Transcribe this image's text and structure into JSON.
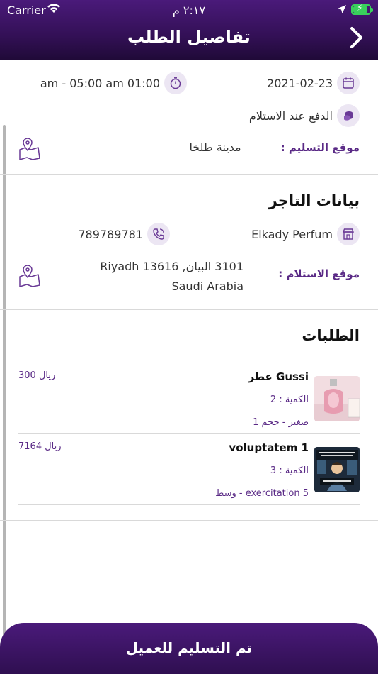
{
  "status_bar": {
    "carrier": "Carrier",
    "time": "٢:١٧ م"
  },
  "nav": {
    "title": "تفاصيل الطلب"
  },
  "delivery": {
    "date": "2021-02-23",
    "time_range": "01:00 am - 05:00 am",
    "payment_method": "الدفع عند الاستلام",
    "location_label": "موقع التسليم :",
    "location_value": "مدينة طلخا"
  },
  "merchant": {
    "heading": "بيانات التاجر",
    "name": "Elkady Perfum",
    "phone": "789789781",
    "pickup_label": "موقع الاستلام :",
    "address_line1": "3101 البيان, Riyadh 13616",
    "address_line2": "Saudi Arabia"
  },
  "orders": {
    "heading": "الطلبات",
    "items": [
      {
        "name": "عطر Gussi",
        "quantity": "الكمية : 2",
        "variant": "صغير - حجم 1",
        "price": "300 ريال"
      },
      {
        "name": "voluptatem 1",
        "quantity": "الكمية : 3",
        "variant": "وسط - exercitation 5",
        "price": "7164 ريال"
      }
    ]
  },
  "action": {
    "label": "تم التسليم للعميل"
  },
  "colors": {
    "primary": "#4a1a7a",
    "accent_text": "#5a2a86",
    "icon_bg": "#ece6f3"
  }
}
